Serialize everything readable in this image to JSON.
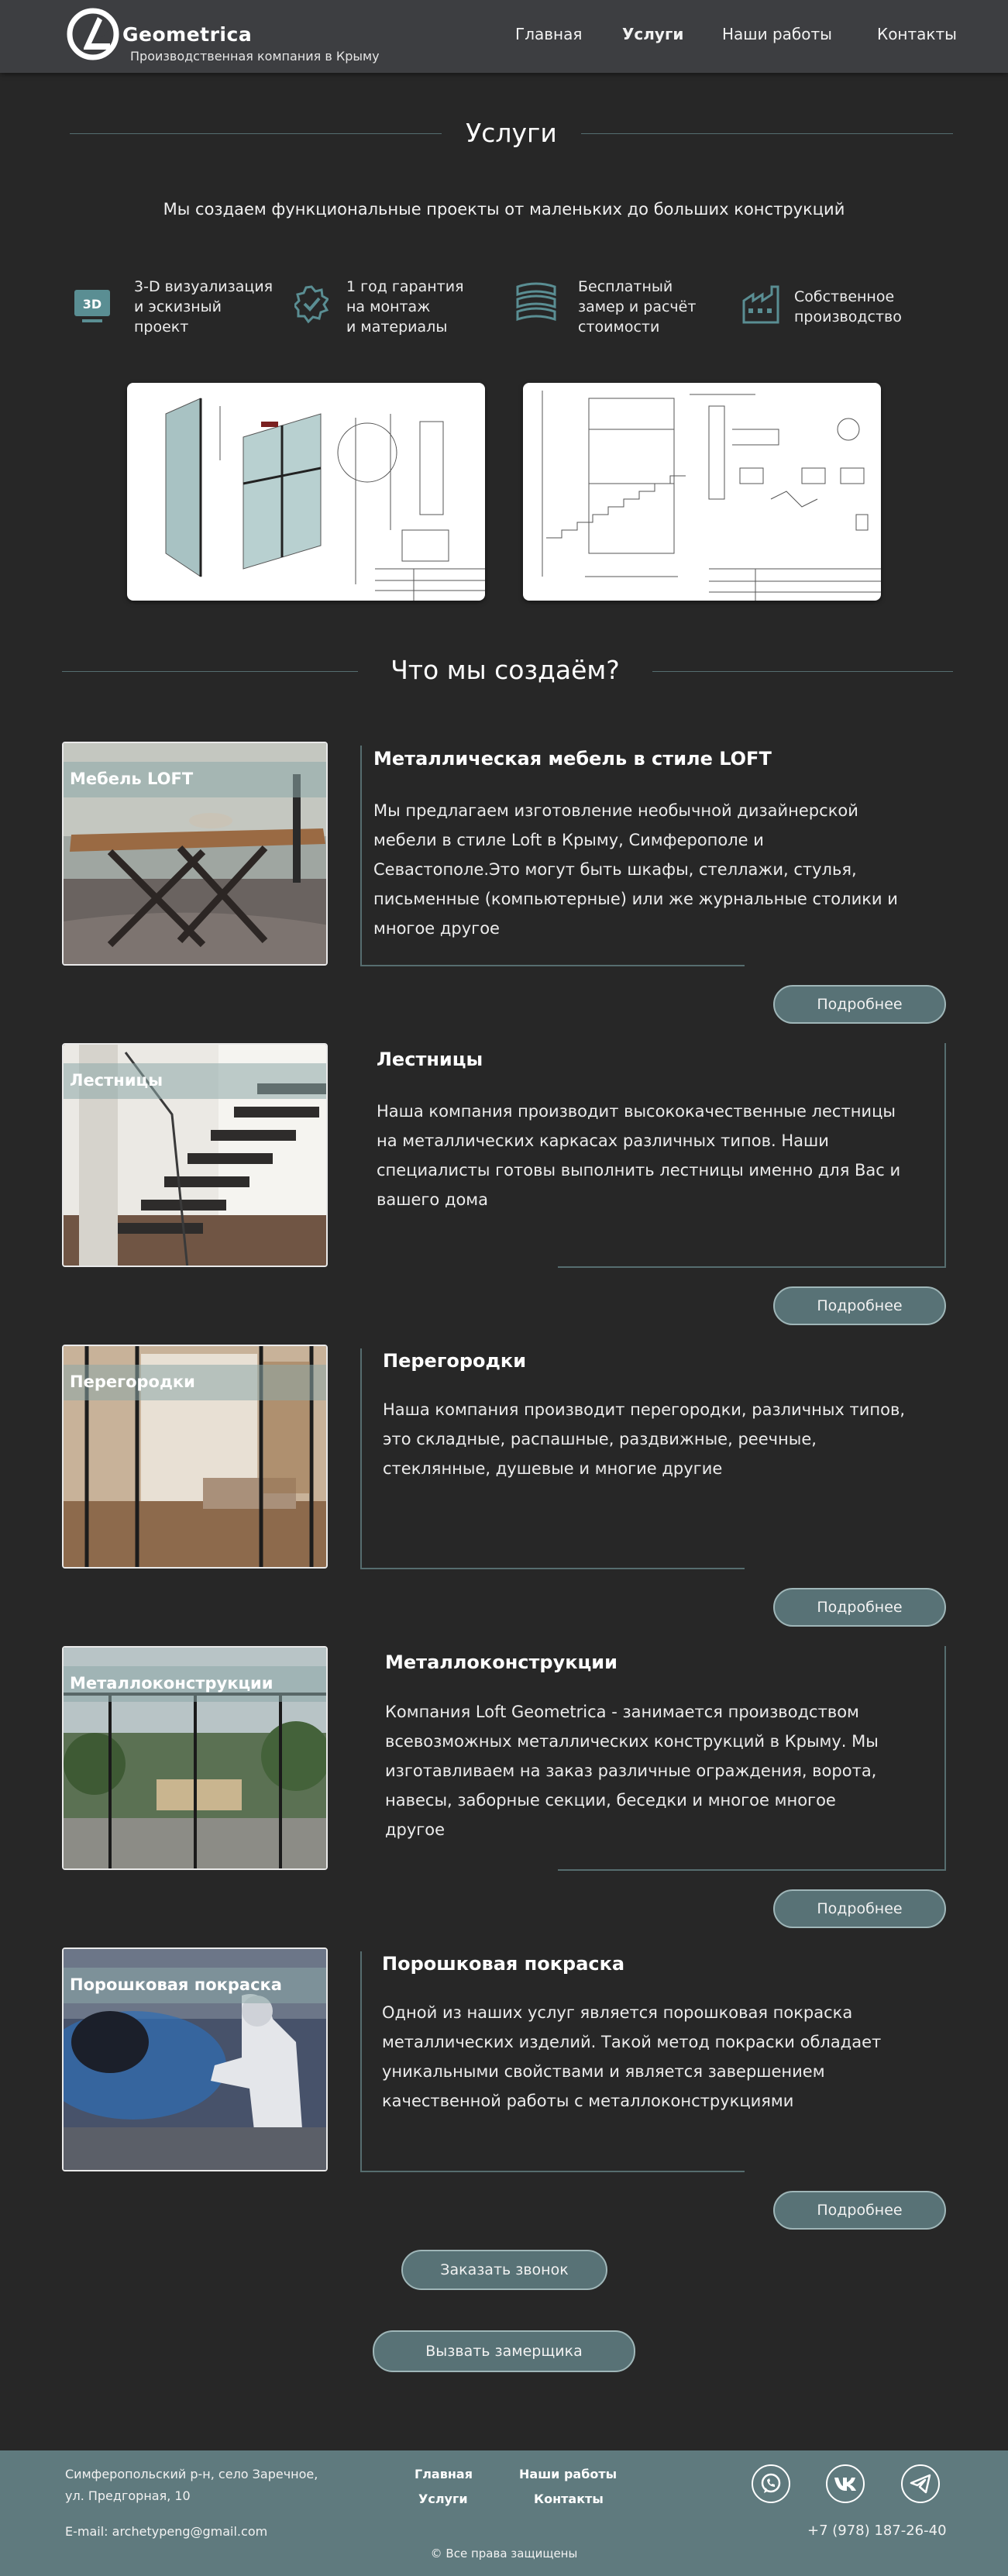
{
  "header": {
    "brand": "Geometrica",
    "tagline": "Производственная компания в Крыму",
    "nav": [
      "Главная",
      "Услуги",
      "Наши работы",
      "Контакты"
    ],
    "active_nav": "Услуги"
  },
  "services_section": {
    "title": "Услуги",
    "subtitle": "Мы создаем функциональные проекты от маленьких до больших конструкций",
    "features": [
      {
        "icon": "3d-monitor-icon",
        "icon_text": "3D",
        "lines": [
          "3-D визуализация",
          "и эскизный",
          "проект"
        ]
      },
      {
        "icon": "badge-check-icon",
        "lines": [
          "1 год гарантия",
          "на монтаж",
          "и материалы"
        ]
      },
      {
        "icon": "tape-measure-icon",
        "lines": [
          "Бесплатный",
          "замер и расчёт",
          "стоимости"
        ]
      },
      {
        "icon": "factory-icon",
        "lines": [
          "Собственное",
          "производство"
        ]
      }
    ],
    "drawings": [
      "partition-drawing",
      "staircase-drawing"
    ]
  },
  "what_section": {
    "title": "Что мы создаём?"
  },
  "cards": [
    {
      "label": "Мебель LOFT",
      "title": "Металлическая мебель в стиле LOFT",
      "lines": [
        "Мы предлагаем изготовление необычной дизайнерской",
        "мебели в стиле Loft в Крыму, Симферополе и",
        "Севастополе.Это могут быть шкафы, стеллажи, стулья,",
        "письменные (компьютерные) или же журнальные столики и",
        "многое другое"
      ],
      "button": "Подробнее"
    },
    {
      "label": "Лестницы",
      "title": "Лестницы",
      "lines": [
        "Наша компания производит высококачественные лестницы",
        "на металлических каркасах различных типов. Наши",
        "специалисты готовы выполнить лестницы именно для Вас и",
        "вашего дома"
      ],
      "button": "Подробнее"
    },
    {
      "label": "Перегородки",
      "title": "Перегородки",
      "lines": [
        "Наша компания производит перегородки, различных типов,",
        "это складные, распашные, раздвижные, реечные,",
        "стеклянные, душевые и многие другие"
      ],
      "button": "Подробнее"
    },
    {
      "label": "Металлоконструкции",
      "title": "Металлоконструкции",
      "lines": [
        "Компания Loft Geometrica - занимается производством",
        "всевозможных металлических конструкций в Крыму. Мы",
        "изготавливаем на заказ различные ограждения, ворота,",
        "навесы, заборные секции, беседки и многое многое",
        "другое"
      ],
      "button": "Подробнее"
    },
    {
      "label": "Порошковая покраска",
      "title": "Порошковая покраска",
      "lines": [
        "Одной из наших услуг является порошковая покраска",
        "металлических изделий. Такой метод покраски обладает",
        "уникальными свойствами и является завершением",
        "качественной работы с металлоконструкциями"
      ],
      "button": "Подробнее"
    }
  ],
  "cta": {
    "call": "Заказать звонок",
    "measure": "Вызвать замерщика"
  },
  "footer": {
    "address_line1": "Симферопольский р-н, село Заречное,",
    "address_line2": "ул. Предгорная, 10",
    "email": "E-mail: archetypeng@gmail.com",
    "links": [
      "Главная",
      "Наши работы",
      "Услуги",
      "Контакты"
    ],
    "phone": "+7 (978) 187-26-40",
    "copyright": "© Все права защищены",
    "socials": [
      "whatsapp-icon",
      "vk-icon",
      "telegram-icon"
    ]
  },
  "colors": {
    "background": "#272727",
    "header": "#3d3e41",
    "accent": "#587276",
    "footer": "#5f7a7e"
  }
}
